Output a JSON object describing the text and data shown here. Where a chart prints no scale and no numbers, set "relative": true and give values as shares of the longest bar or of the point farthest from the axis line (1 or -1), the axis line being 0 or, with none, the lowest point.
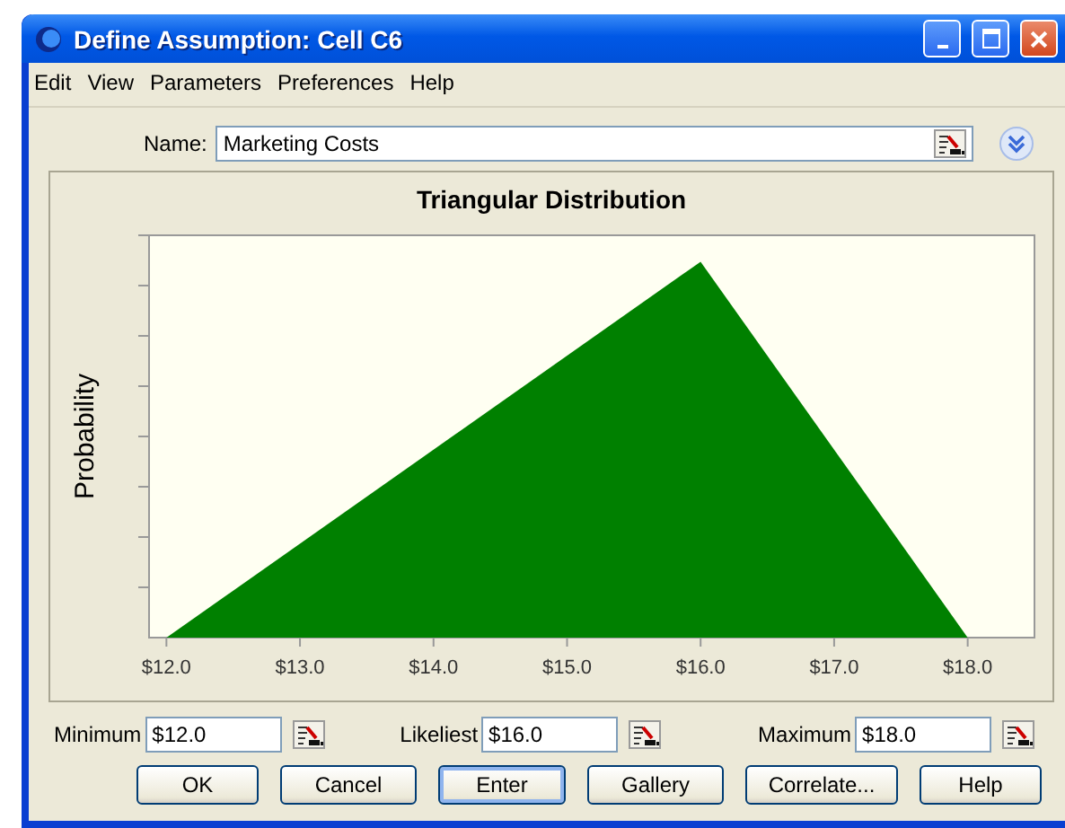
{
  "window": {
    "title": "Define Assumption: Cell C6"
  },
  "menu": [
    "Edit",
    "View",
    "Parameters",
    "Preferences",
    "Help"
  ],
  "name_field": {
    "label": "Name:",
    "value": "Marketing Costs"
  },
  "chart": {
    "chart_data": {
      "type": "area",
      "title": "Triangular Distribution",
      "ylabel": "Probability",
      "x": [
        12,
        16,
        18
      ],
      "values": [
        0,
        1,
        0
      ],
      "relative": true,
      "xlim": [
        11.87,
        18.5
      ],
      "xticks": [
        {
          "value": 12,
          "label": "$12.0"
        },
        {
          "value": 13,
          "label": "$13.0"
        },
        {
          "value": 14,
          "label": "$14.0"
        },
        {
          "value": 15,
          "label": "$15.0"
        },
        {
          "value": 16,
          "label": "$16.0"
        },
        {
          "value": 17,
          "label": "$17.0"
        },
        {
          "value": 18,
          "label": "$18.0"
        }
      ]
    }
  },
  "parameters": [
    {
      "label": "Minimum",
      "value": "$12.0"
    },
    {
      "label": "Likeliest",
      "value": "$16.0"
    },
    {
      "label": "Maximum",
      "value": "$18.0"
    }
  ],
  "buttons": [
    {
      "label": "OK",
      "selected": false
    },
    {
      "label": "Cancel",
      "selected": false
    },
    {
      "label": "Enter",
      "selected": true
    },
    {
      "label": "Gallery",
      "selected": false
    },
    {
      "label": "Correlate...",
      "selected": false
    },
    {
      "label": "Help",
      "selected": false
    }
  ]
}
